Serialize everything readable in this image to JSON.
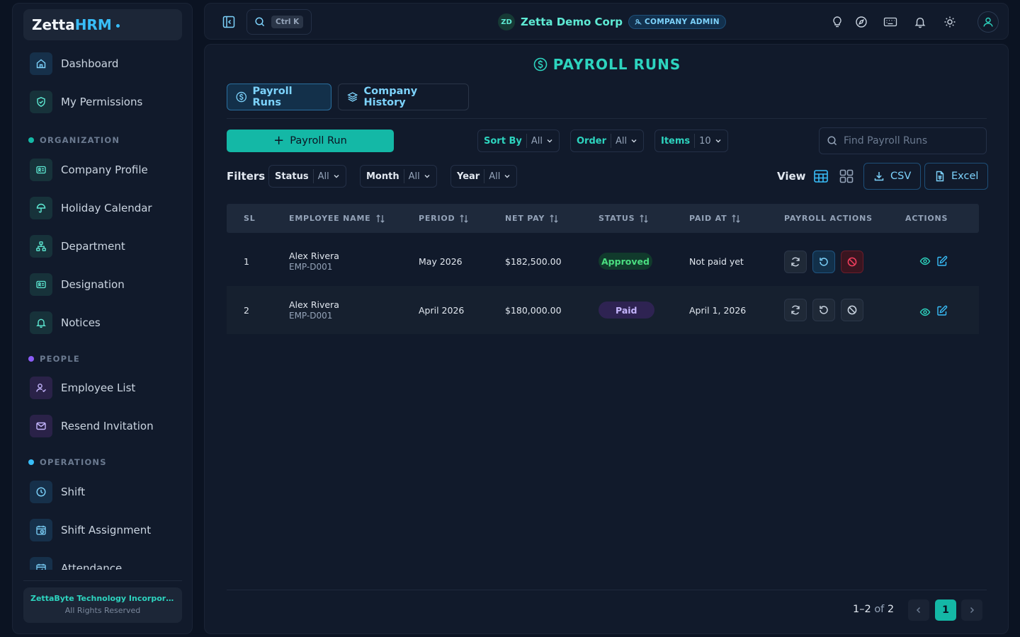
{
  "brand": {
    "name_part1": "Zetta",
    "name_part2": "HRM"
  },
  "sidebar": {
    "top_items": [
      {
        "label": "Dashboard",
        "icon": "home-icon"
      },
      {
        "label": "My Permissions",
        "icon": "shield-check-icon"
      }
    ],
    "sections": [
      {
        "title": "ORGANIZATION",
        "color": "#14b8a6"
      },
      {
        "title": "PEOPLE",
        "color": "#8b5cf6"
      },
      {
        "title": "OPERATIONS",
        "color": "#38bdf8"
      }
    ],
    "organization_items": [
      {
        "label": "Company Profile",
        "icon": "id-card-icon"
      },
      {
        "label": "Holiday Calendar",
        "icon": "umbrella-icon"
      },
      {
        "label": "Department",
        "icon": "org-chart-icon"
      },
      {
        "label": "Designation",
        "icon": "badge-card-icon"
      },
      {
        "label": "Notices",
        "icon": "bell-icon"
      }
    ],
    "people_items": [
      {
        "label": "Employee List",
        "icon": "user-check-icon"
      },
      {
        "label": "Resend Invitation",
        "icon": "mail-icon"
      }
    ],
    "operations_items": [
      {
        "label": "Shift",
        "icon": "clock-icon"
      },
      {
        "label": "Shift Assignment",
        "icon": "calendar-clock-icon"
      },
      {
        "label": "Attendance",
        "icon": "calendar-check-icon"
      }
    ],
    "footer": {
      "company": "ZettaByte Technology Incorporat...",
      "rights": "All Rights Reserved"
    }
  },
  "topbar": {
    "search_shortcut": "Ctrl K",
    "company_initials": "ZD",
    "company_name": "Zetta Demo Corp",
    "role_badge": "COMPANY ADMIN"
  },
  "page": {
    "title": "PAYROLL RUNS",
    "tabs": [
      {
        "label": "Payroll Runs",
        "active": true
      },
      {
        "label": "Company History",
        "active": false
      }
    ],
    "add_button": "Payroll Run",
    "sort_by": {
      "label": "Sort By",
      "value": "All"
    },
    "order": {
      "label": "Order",
      "value": "All"
    },
    "items": {
      "label": "Items",
      "value": "10"
    },
    "search_placeholder": "Find Payroll Runs",
    "filters_label": "Filters",
    "filters": [
      {
        "label": "Status",
        "value": "All"
      },
      {
        "label": "Month",
        "value": "All"
      },
      {
        "label": "Year",
        "value": "All"
      }
    ],
    "view_label": "View",
    "export_csv": "CSV",
    "export_excel": "Excel"
  },
  "table": {
    "columns": [
      "SL",
      "EMPLOYEE NAME",
      "PERIOD",
      "NET PAY",
      "STATUS",
      "PAID AT",
      "PAYROLL ACTIONS",
      "ACTIONS"
    ],
    "rows": [
      {
        "sl": "1",
        "name": "Alex Rivera",
        "emp_id": "EMP-D001",
        "period": "May 2026",
        "net_pay": "$182,500.00",
        "status": "Approved",
        "paid_at": "Not paid yet"
      },
      {
        "sl": "2",
        "name": "Alex Rivera",
        "emp_id": "EMP-D001",
        "period": "April 2026",
        "net_pay": "$180,000.00",
        "status": "Paid",
        "paid_at": "April 1, 2026"
      }
    ]
  },
  "pagination": {
    "range": "1–2",
    "of_label": "of",
    "total": "2",
    "current_page": "1"
  },
  "colors": {
    "accent": "#14b8a6",
    "link": "#38bdf8",
    "background": "#0b1322",
    "panel": "#111a2b"
  }
}
